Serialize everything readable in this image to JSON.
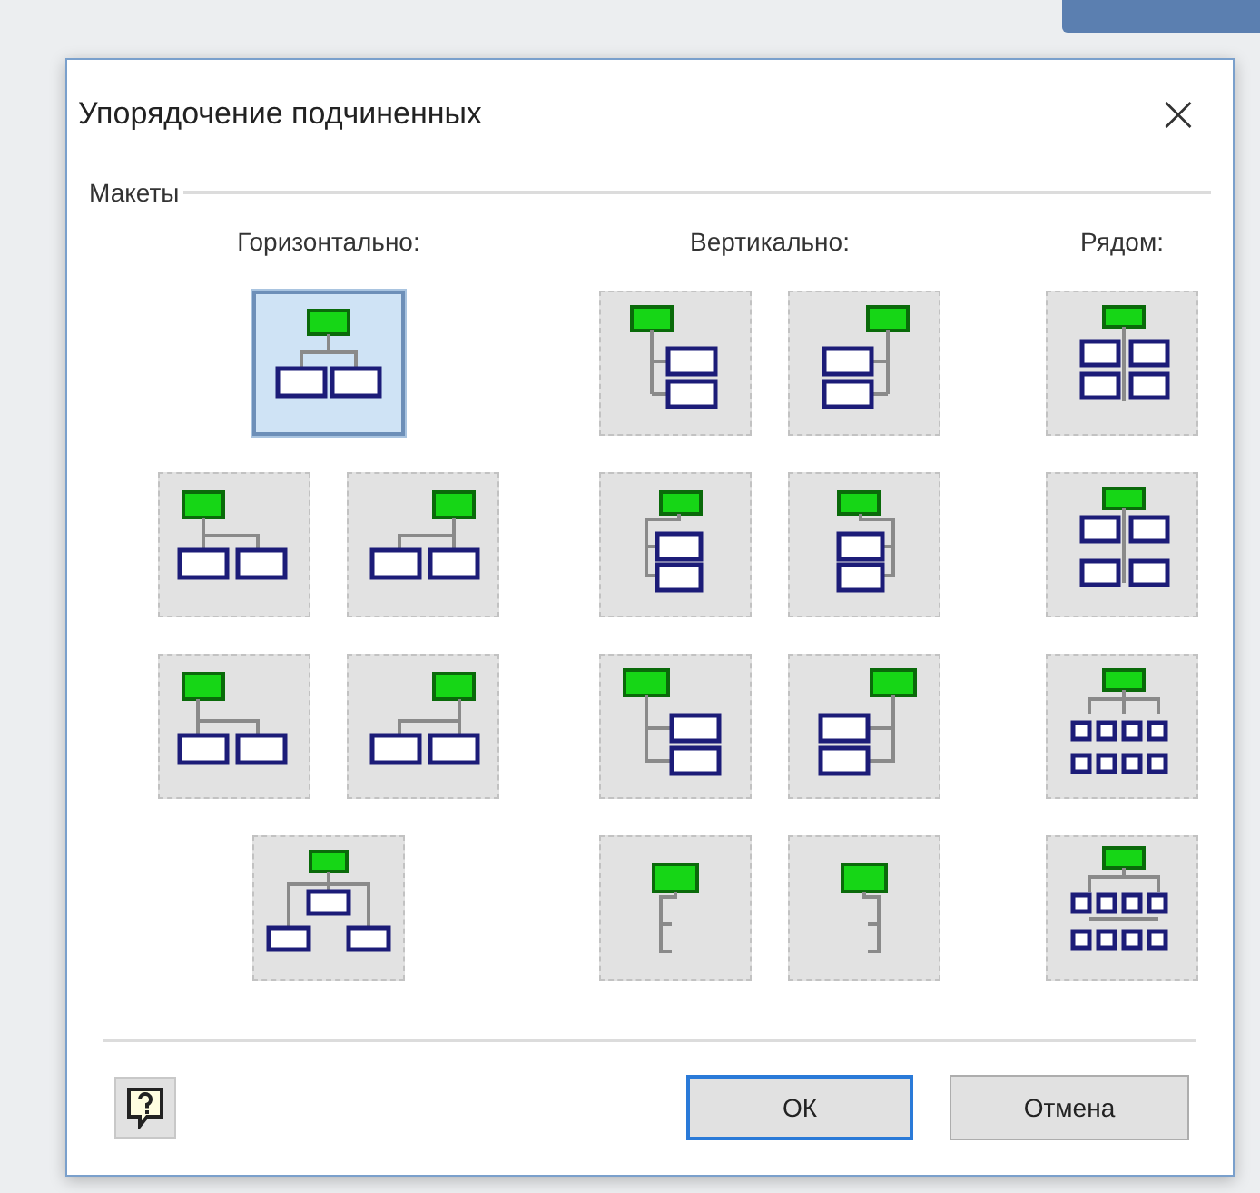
{
  "window": {
    "title": "Упорядочение подчиненных",
    "close": "×"
  },
  "group": {
    "label": "Макеты"
  },
  "columns": [
    {
      "heading": "Горизонтально:",
      "rows": [
        [
          {
            "kind": "h-center",
            "selected": true
          }
        ],
        [
          {
            "kind": "h-left",
            "selected": false
          },
          {
            "kind": "h-right",
            "selected": false
          }
        ],
        [
          {
            "kind": "h-left-low",
            "selected": false
          },
          {
            "kind": "h-right-low",
            "selected": false
          }
        ],
        [
          {
            "kind": "h-staggered",
            "selected": false
          }
        ]
      ]
    },
    {
      "heading": "Вертикально:",
      "rows": [
        [
          {
            "kind": "v-right",
            "selected": false
          },
          {
            "kind": "v-left",
            "selected": false
          }
        ],
        [
          {
            "kind": "v-center-right",
            "selected": false
          },
          {
            "kind": "v-center-left",
            "selected": false
          }
        ],
        [
          {
            "kind": "v-wide-right",
            "selected": false
          },
          {
            "kind": "v-wide-left",
            "selected": false
          }
        ],
        [
          {
            "kind": "v-stub-left",
            "selected": false
          },
          {
            "kind": "v-stub-right",
            "selected": false
          }
        ]
      ]
    },
    {
      "heading": "Рядом:",
      "rows": [
        [
          {
            "kind": "s-two",
            "selected": false
          }
        ],
        [
          {
            "kind": "s-two-spaced",
            "selected": false
          }
        ],
        [
          {
            "kind": "s-grid",
            "selected": false
          }
        ],
        [
          {
            "kind": "s-grid-split",
            "selected": false
          }
        ]
      ]
    }
  ],
  "buttons": [
    {
      "label": "ОК",
      "default": true
    },
    {
      "label": "Отмена",
      "default": false
    }
  ]
}
